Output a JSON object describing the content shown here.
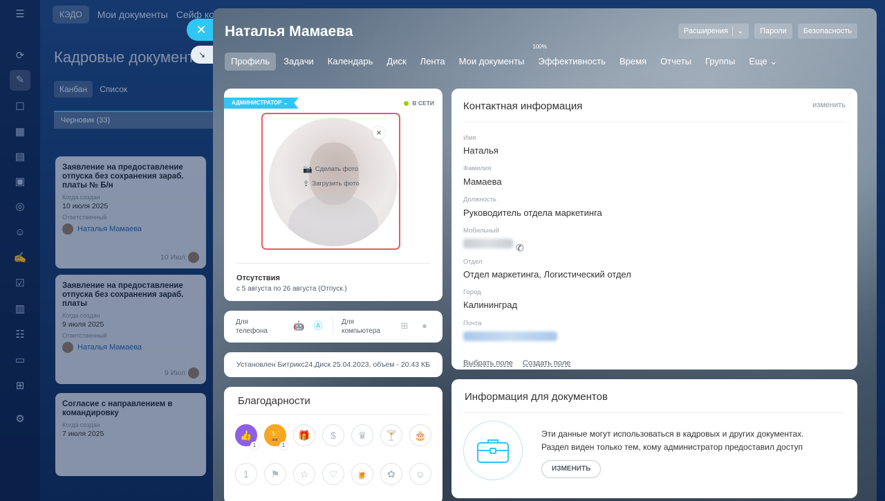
{
  "background": {
    "top_nav": [
      "КЭДО",
      "Мои документы",
      "Сейф ко"
    ],
    "title": "Кадровые документ",
    "views": [
      "Канбан",
      "Список"
    ],
    "column": "Черновик",
    "column_count": "(33)",
    "cards": [
      {
        "title": "Заявление на предоставление отпуска без сохранения зараб. платы № Б/н",
        "created_label": "Когда создан",
        "created": "10 июля 2025",
        "resp_label": "Ответственный",
        "resp": "Наталья Мамаева",
        "date_short": "10 Июл"
      },
      {
        "title": "Заявление на предоставление отпуска без сохранения зараб. платы",
        "created_label": "Когда создан",
        "created": "9 июля 2025",
        "resp_label": "Ответственный",
        "resp": "Наталья Мамаева",
        "date_short": "9 Июл"
      },
      {
        "title": "Согласие с направлением в командировку",
        "created_label": "Когда создан",
        "created": "7 июля 2025",
        "resp_label": "",
        "resp": "",
        "date_short": ""
      }
    ]
  },
  "slider": {
    "close_icon": "close-icon",
    "user_name": "Наталья Мамаева",
    "header_buttons": {
      "extensions": "Расширения",
      "passwords": "Пароли",
      "security": "Безопасность"
    },
    "tabs": [
      {
        "label": "Профиль",
        "sup": ""
      },
      {
        "label": "Задачи",
        "sup": ""
      },
      {
        "label": "Календарь",
        "sup": ""
      },
      {
        "label": "Диск",
        "sup": ""
      },
      {
        "label": "Лента",
        "sup": ""
      },
      {
        "label": "Мои документы",
        "sup": ""
      },
      {
        "label": "Эффективность",
        "sup": "100%"
      },
      {
        "label": "Время",
        "sup": ""
      },
      {
        "label": "Отчеты",
        "sup": ""
      },
      {
        "label": "Группы",
        "sup": ""
      },
      {
        "label": "Еще",
        "sup": ""
      }
    ]
  },
  "avatar_card": {
    "role": "АДМИНИСТРАТОР",
    "status": "В СЕТИ",
    "take_photo": "Сделать фото",
    "upload_photo": "Загрузить фото",
    "absence_title": "Отсутствия",
    "absence_value": "с 5 августа по 26 августа (Отпуск.)"
  },
  "apps": {
    "phone": "Для телефона",
    "computer": "Для компьютера"
  },
  "disk_info": "Установлен Битрикс24.Диск 25.04.2023, объем - 20.43 КБ",
  "thanks": {
    "title": "Благодарности",
    "badges": [
      {
        "icon": "thumbs-up-icon",
        "glyph": "👍",
        "count": "1",
        "filled": "purple"
      },
      {
        "icon": "trophy-icon",
        "glyph": "🏆",
        "count": "1",
        "filled": "orange"
      },
      {
        "icon": "gift-icon",
        "glyph": "🎁",
        "count": "",
        "filled": ""
      },
      {
        "icon": "money-bag-icon",
        "glyph": "$",
        "count": "",
        "filled": ""
      },
      {
        "icon": "crown-icon",
        "glyph": "♛",
        "count": "",
        "filled": ""
      },
      {
        "icon": "cocktail-icon",
        "glyph": "🍸",
        "count": "",
        "filled": ""
      },
      {
        "icon": "cake-icon",
        "glyph": "🎂",
        "count": "",
        "filled": ""
      },
      {
        "icon": "number-one-icon",
        "glyph": "1",
        "count": "",
        "filled": ""
      },
      {
        "icon": "flag-icon",
        "glyph": "⚑",
        "count": "",
        "filled": ""
      },
      {
        "icon": "star-icon",
        "glyph": "☆",
        "count": "",
        "filled": ""
      },
      {
        "icon": "heart-icon",
        "glyph": "♡",
        "count": "",
        "filled": ""
      },
      {
        "icon": "beer-icon",
        "glyph": "🍺",
        "count": "",
        "filled": ""
      },
      {
        "icon": "flower-icon",
        "glyph": "✿",
        "count": "",
        "filled": ""
      },
      {
        "icon": "smile-icon",
        "glyph": "☺",
        "count": "",
        "filled": ""
      }
    ]
  },
  "contact": {
    "title": "Контактная информация",
    "edit": "изменить",
    "fields": {
      "name_label": "Имя",
      "name": "Наталья",
      "surname_label": "Фамилия",
      "surname": "Мамаева",
      "position_label": "Должность",
      "position": "Руководитель отдела маркетинга",
      "mobile_label": "Мобильный",
      "dept_label": "Отдел",
      "dept": "Отдел маркетинга, Логистический отдел",
      "city_label": "Город",
      "city": "Калининград",
      "email_label": "Почта"
    },
    "choose_field": "Выбрать поле",
    "create_field": "Создать поле"
  },
  "docs": {
    "title": "Информация для документов",
    "text1": "Эти данные могут использоваться в кадровых и других документах.",
    "text2": "Раздел виден только тем, кому администратор предоставил доступ",
    "button": "ИЗМЕНИТЬ"
  },
  "colors": {
    "accent": "#2fc6f6",
    "highlight": "#e55c62",
    "online": "#9dcf00"
  }
}
